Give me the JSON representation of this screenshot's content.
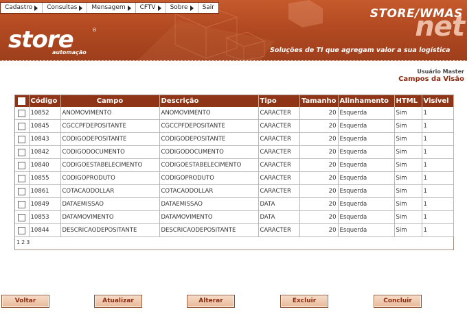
{
  "menu": [
    {
      "label": "Cadastro",
      "arrow": true
    },
    {
      "label": "Consultas",
      "arrow": true
    },
    {
      "label": "Mensagem",
      "arrow": true
    },
    {
      "label": "CFTV",
      "arrow": true
    },
    {
      "label": "Sobre",
      "arrow": true
    },
    {
      "label": "Sair",
      "arrow": false
    }
  ],
  "logo": {
    "name": "store",
    "sub": "automação",
    "reg": "®"
  },
  "brand": {
    "title": "STORE/WMAS",
    "net": "net",
    "tagline": "Soluções de TI que agregam valor a sua logística"
  },
  "user": {
    "label": "Usuário Master"
  },
  "page": {
    "title": "Campos da Visão"
  },
  "table": {
    "headers": [
      "Código",
      "Campo",
      "Descrição",
      "Tipo",
      "Tamanho",
      "Alinhamento",
      "HTML",
      "Visível"
    ],
    "rows": [
      [
        "10852",
        "ANOMOVIMENTO",
        "ANOMOVIMENTO",
        "CARACTER",
        "20",
        "Esquerda",
        "Sim",
        "1"
      ],
      [
        "10845",
        "CGCCPFDEPOSITANTE",
        "CGCCPFDEPOSITANTE",
        "CARACTER",
        "20",
        "Esquerda",
        "Sim",
        "1"
      ],
      [
        "10843",
        "CODIGODEPOSITANTE",
        "CODIGODEPOSITANTE",
        "CARACTER",
        "20",
        "Esquerda",
        "Sim",
        "1"
      ],
      [
        "10842",
        "CODIGODOCUMENTO",
        "CODIGODOCUMENTO",
        "CARACTER",
        "20",
        "Esquerda",
        "Sim",
        "1"
      ],
      [
        "10840",
        "CODIGOESTABELECIMENTO",
        "CODIGOESTABELECIMENTO",
        "CARACTER",
        "20",
        "Esquerda",
        "Sim",
        "1"
      ],
      [
        "10855",
        "CODIGOPRODUTO",
        "CODIGOPRODUTO",
        "CARACTER",
        "20",
        "Esquerda",
        "Sim",
        "1"
      ],
      [
        "10861",
        "COTACAODOLLAR",
        "COTACAODOLLAR",
        "CARACTER",
        "20",
        "Esquerda",
        "Sim",
        "1"
      ],
      [
        "10849",
        "DATAEMISSAO",
        "DATAEMISSAO",
        "DATA",
        "20",
        "Esquerda",
        "Sim",
        "1"
      ],
      [
        "10853",
        "DATAMOVIMENTO",
        "DATAMOVIMENTO",
        "DATA",
        "20",
        "Esquerda",
        "Sim",
        "1"
      ],
      [
        "10844",
        "DESCRICAODEPOSITANTE",
        "DESCRICAODEPOSITANTE",
        "CARACTER",
        "20",
        "Esquerda",
        "Sim",
        "1"
      ]
    ],
    "pages": [
      "1",
      "2",
      "3"
    ]
  },
  "buttons": [
    "Voltar",
    "Atualizar",
    "Alterar",
    "Excluir",
    "Concluir"
  ],
  "colors": {
    "header": "#b24a22",
    "table_header": "#8f3416",
    "accent": "#8b2a0e",
    "button": "#e8b797"
  }
}
